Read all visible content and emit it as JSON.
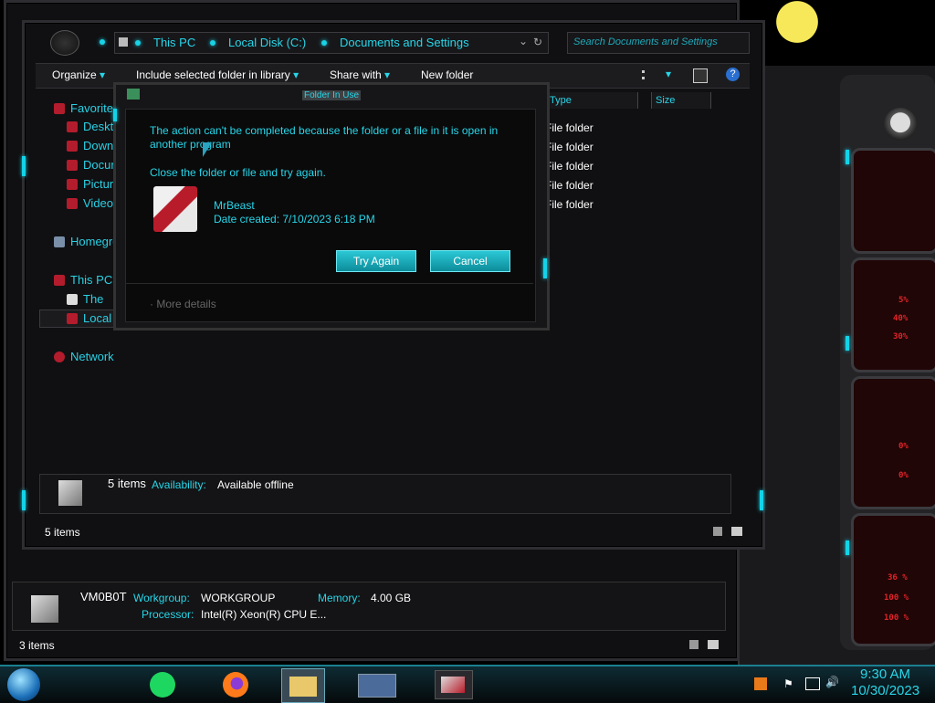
{
  "explorer": {
    "breadcrumb": [
      "This PC",
      "Local Disk (C:)",
      "Documents and Settings"
    ],
    "search_placeholder": "Search Documents and Settings",
    "toolbar": {
      "organize": "Organize",
      "include": "Include selected folder in library",
      "share": "Share with",
      "new_folder": "New folder"
    },
    "nav": {
      "favorites": "Favorites",
      "desktop": "Desktop",
      "downloads": "Downloads",
      "documents": "Documents",
      "pictures": "Pictures",
      "videos": "Videos",
      "homegroup": "Homegroup",
      "this_pc": "This PC",
      "the": "The",
      "local": "Local Disk (C:)",
      "network": "Network"
    },
    "columns": {
      "type": "Type",
      "size": "Size"
    },
    "rows": [
      "File folder",
      "File folder",
      "File folder",
      "File folder",
      "File folder"
    ],
    "details": {
      "count": "5 items",
      "availability_label": "Availability:",
      "availability_value": "Available offline"
    },
    "status": "5 items"
  },
  "dialog": {
    "title": "Folder In Use",
    "message": "The action can't be completed because the folder or a file in it is open in another program",
    "instruction": "Close the folder or file and try again.",
    "file_name": "MrBeast",
    "file_date": "Date created: 7/10/2023 6:18 PM",
    "try_again": "Try Again",
    "cancel": "Cancel",
    "more_details": "More details"
  },
  "computer": {
    "name": "VM0B0T",
    "workgroup_label": "Workgroup:",
    "workgroup_value": "WORKGROUP",
    "memory_label": "Memory:",
    "memory_value": "4.00 GB",
    "processor_label": "Processor:",
    "processor_value": "Intel(R) Xeon(R) CPU E...",
    "status": "3 items"
  },
  "gadget": {
    "percent_values": [
      "5%",
      "40%",
      "30%",
      "0%",
      "0%",
      "36 %",
      "100 %",
      "100 %"
    ]
  },
  "taskbar": {
    "time": "9:30 AM",
    "date": "10/30/2023"
  },
  "colors": {
    "accent": "#27d6e8",
    "alert_red": "#e2232a",
    "button": "#1aa9b8"
  }
}
